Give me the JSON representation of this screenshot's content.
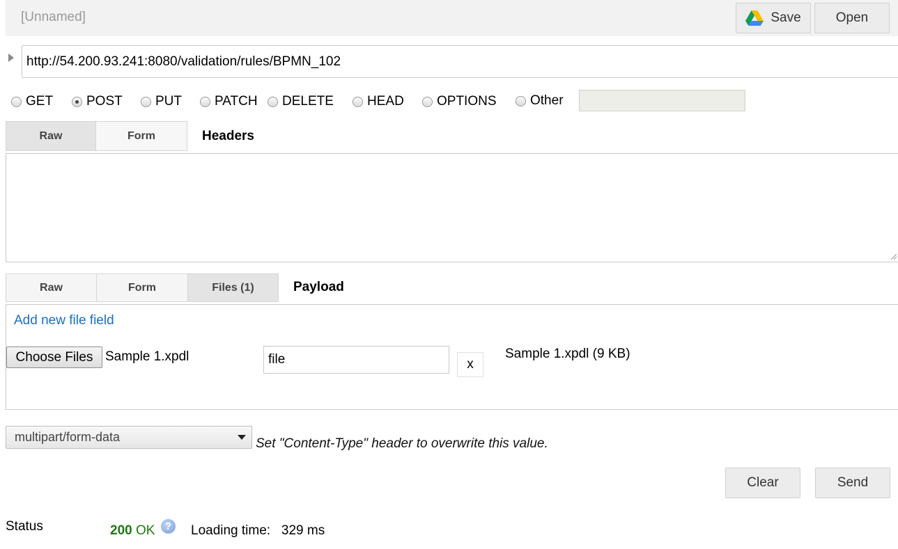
{
  "header": {
    "title": "[Unnamed]",
    "save_label": "Save",
    "open_label": "Open"
  },
  "request": {
    "url": "http://54.200.93.241:8080/validation/rules/BPMN_102",
    "methods": [
      {
        "label": "GET",
        "checked": false
      },
      {
        "label": "POST",
        "checked": true
      },
      {
        "label": "PUT",
        "checked": false
      },
      {
        "label": "PATCH",
        "checked": false
      },
      {
        "label": "DELETE",
        "checked": false
      },
      {
        "label": "HEAD",
        "checked": false
      },
      {
        "label": "OPTIONS",
        "checked": false
      },
      {
        "label": "Other",
        "checked": false
      }
    ],
    "other_value": ""
  },
  "headers_section": {
    "tabs": [
      {
        "label": "Raw",
        "active": true
      },
      {
        "label": "Form",
        "active": false
      }
    ],
    "label": "Headers",
    "value": ""
  },
  "payload_section": {
    "tabs": [
      {
        "label": "Raw",
        "active": false
      },
      {
        "label": "Form",
        "active": false
      },
      {
        "label": "Files (1)",
        "active": true
      }
    ],
    "label": "Payload",
    "add_field_link": "Add new file field",
    "choose_files_label": "Choose Files",
    "chosen_file": "Sample 1.xpdl",
    "field_name": "file",
    "remove_label": "x",
    "file_info": "Sample 1.xpdl (9 KB)"
  },
  "encoding": {
    "selected": "multipart/form-data",
    "hint": "Set \"Content-Type\" header to overwrite this value."
  },
  "actions": {
    "clear_label": "Clear",
    "send_label": "Send"
  },
  "status": {
    "label": "Status",
    "code": "200",
    "text": "OK",
    "loading_label": "Loading time:",
    "loading_value": "329 ms"
  },
  "colors": {
    "status_ok": "#1e7a12",
    "link": "#1a6fc4"
  }
}
